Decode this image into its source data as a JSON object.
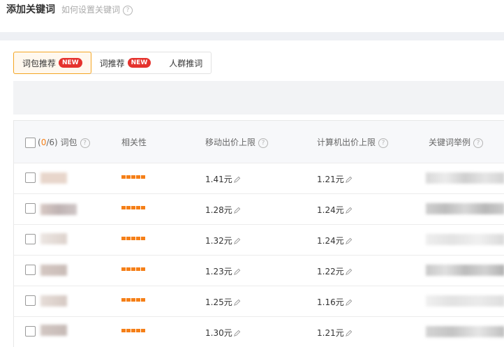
{
  "header": {
    "title": "添加关键词",
    "help_text": "如何设置关键词",
    "help_icon": "?"
  },
  "tabs": [
    {
      "label": "词包推荐",
      "badge": "NEW",
      "active": true
    },
    {
      "label": "词推荐",
      "badge": "NEW",
      "active": false
    },
    {
      "label": "人群推词",
      "badge": "",
      "active": false
    }
  ],
  "table": {
    "selection": {
      "open": "(",
      "selected": "0",
      "sep": "/",
      "total": "6",
      "close": ")",
      "label": "词包"
    },
    "columns": {
      "relevance": "相关性",
      "mobile_bid": "移动出价上限",
      "pc_bid": "计算机出价上限",
      "examples": "关键词举例"
    },
    "rows": [
      {
        "relevance": 5,
        "mobile": "1.41元",
        "pc": "1.21元"
      },
      {
        "relevance": 5,
        "mobile": "1.28元",
        "pc": "1.24元"
      },
      {
        "relevance": 5,
        "mobile": "1.32元",
        "pc": "1.24元"
      },
      {
        "relevance": 5,
        "mobile": "1.23元",
        "pc": "1.22元"
      },
      {
        "relevance": 5,
        "mobile": "1.25元",
        "pc": "1.16元"
      },
      {
        "relevance": 5,
        "mobile": "1.30元",
        "pc": "1.21元"
      }
    ]
  },
  "colors": {
    "accent": "#f57f17",
    "badge": "#e5322d",
    "active_tab_border": "#f5a623"
  }
}
